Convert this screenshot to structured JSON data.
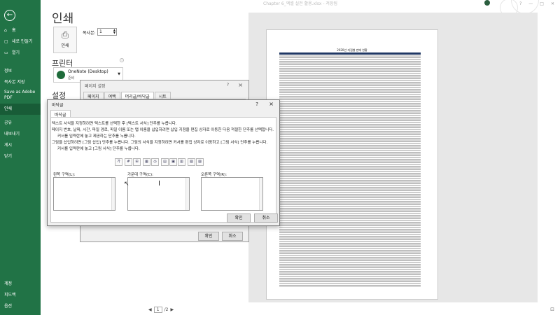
{
  "window": {
    "title": "Chapter 6_엑셀 실전 활용.xlsx  -  저장됨",
    "controls": [
      "?",
      "—",
      "□",
      "✕"
    ]
  },
  "sidebar": {
    "items": [
      {
        "label": "홈",
        "icon": "home-icon"
      },
      {
        "label": "새로 만들기",
        "icon": "new-document-icon"
      },
      {
        "label": "열기",
        "icon": "folder-icon"
      },
      {
        "label": "정보",
        "icon": ""
      },
      {
        "label": "복사본 저장",
        "icon": ""
      },
      {
        "label": "Save as Adobe PDF",
        "icon": ""
      },
      {
        "label": "인쇄",
        "icon": "",
        "active": true
      },
      {
        "label": "공유",
        "icon": ""
      },
      {
        "label": "내보내기",
        "icon": ""
      },
      {
        "label": "게시",
        "icon": ""
      },
      {
        "label": "닫기",
        "icon": ""
      },
      {
        "label": "계정",
        "icon": ""
      },
      {
        "label": "피드백",
        "icon": ""
      },
      {
        "label": "옵션",
        "icon": ""
      }
    ]
  },
  "print": {
    "title": "인쇄",
    "print_button": "인쇄",
    "copies_label": "복사본:",
    "copies_value": "1",
    "printer_heading": "프린터",
    "printer_name": "OneNote (Desktop)",
    "printer_status": "준비",
    "settings_heading": "설정"
  },
  "preview": {
    "page_title": "2020년 지점별 판매 현황",
    "current_page": "1",
    "total_pages": "/2"
  },
  "page_setup_dialog": {
    "title": "페이지 설정",
    "tabs": [
      "페이지",
      "여백",
      "머리글/바닥글",
      "시트"
    ],
    "active_tab": 2,
    "ok": "확인",
    "cancel": "취소"
  },
  "footer_dialog": {
    "title": "바닥글",
    "tab": "바닥글",
    "instructions": [
      "텍스트 서식을 지정하려면 텍스트를 선택한 후 [텍스트 서식] 단추를 누릅니다.",
      "페이지 번호, 날짜, 시간, 파일 경로, 파일 이름 또는 탭 이름을 삽입하려면 삽입 지점을 편집 상자로 이동한 다음 적절한 단추를 선택합니다.",
      "커서를 입력란에 놓고 제공하는 단추를 누릅니다.",
      "그림을 삽입하려면 [그림 삽입] 단추를 누릅니다. 그림의 서식을 지정하려면 커서를 편집 상자로 이동하고 [그림 서식] 단추를 누릅니다.",
      "커서를 입력란에 놓고 [그림 서식] 단추를 누릅니다."
    ],
    "toolbar": [
      "가",
      "#",
      "⊞",
      "▦",
      "◷",
      "▤",
      "▣",
      "▥",
      "▧",
      "▨"
    ],
    "sections": [
      {
        "label": "왼쪽 구역(L):"
      },
      {
        "label": "가운데 구역(C):"
      },
      {
        "label": "오른쪽 구역(R):"
      }
    ],
    "ok": "확인",
    "cancel": "취소"
  }
}
